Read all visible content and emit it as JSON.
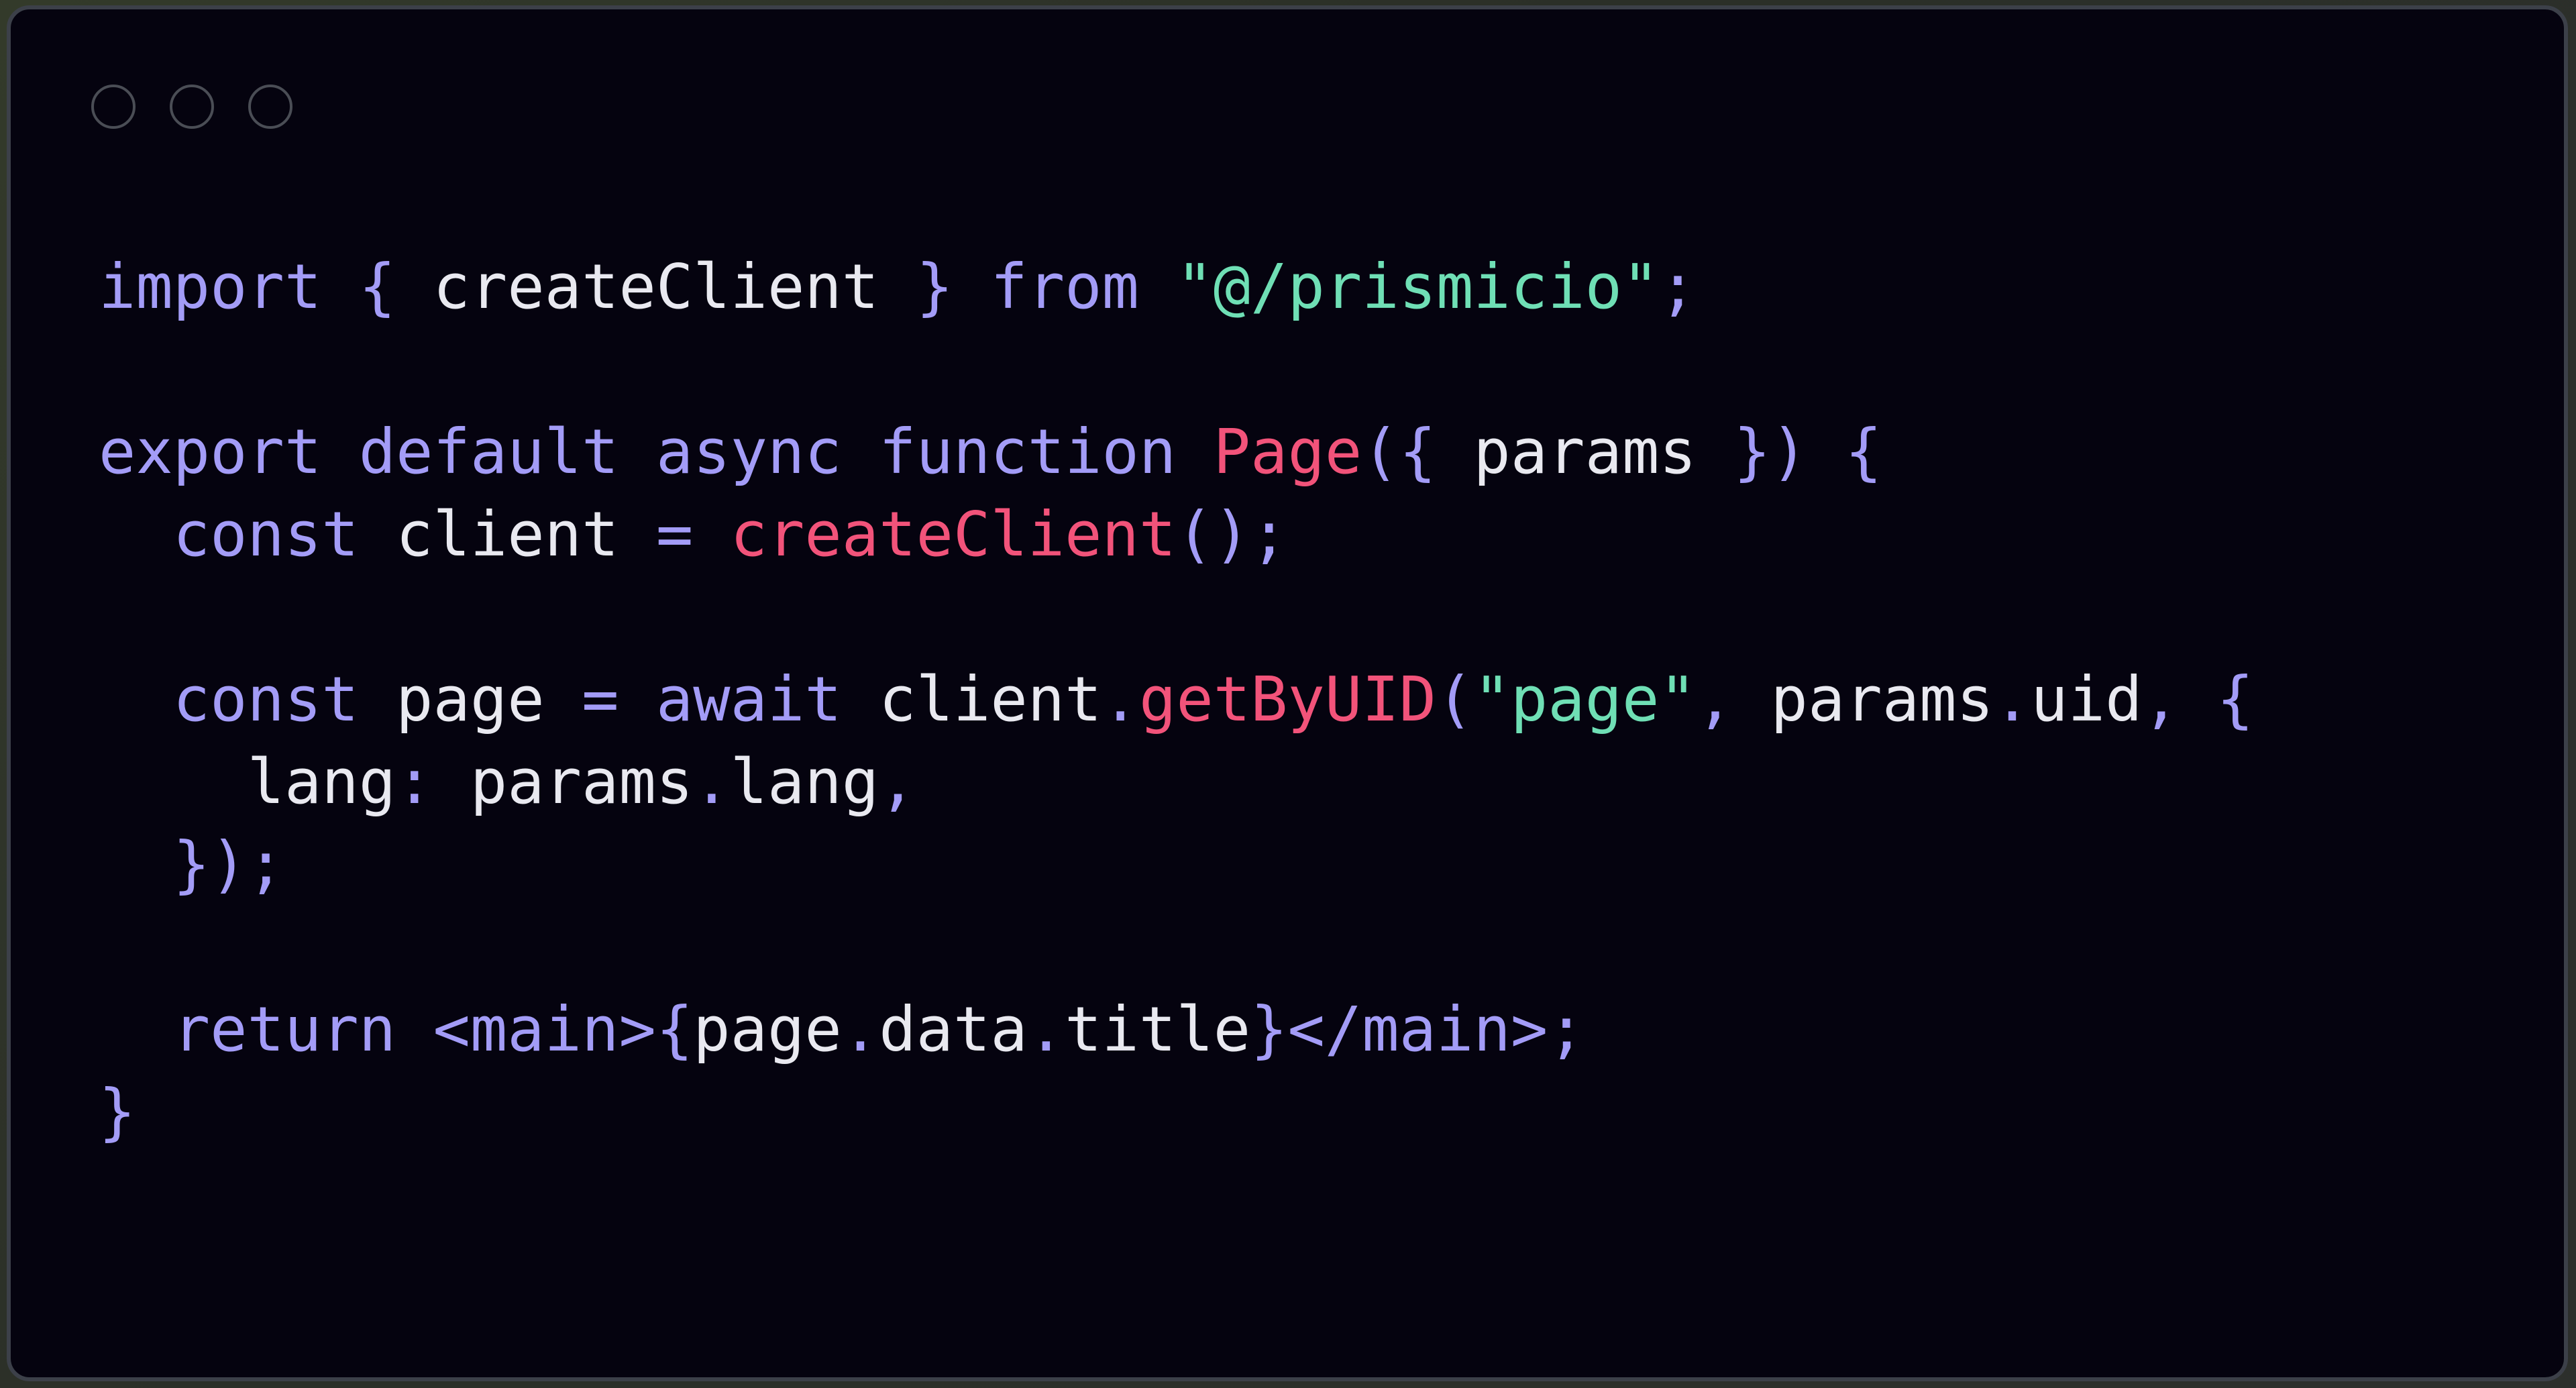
{
  "window": {
    "background_color": "#05030f",
    "border_color": "#3c4049",
    "page_background_color": "#2e3328",
    "traffic_lights": [
      {
        "name": "close-button",
        "label": "close"
      },
      {
        "name": "minimize-button",
        "label": "minimize"
      },
      {
        "name": "maximize-button",
        "label": "maximize"
      }
    ]
  },
  "theme": {
    "keyword_color": "#a39cf7",
    "function_color": "#f2537a",
    "string_color": "#6fdfb5",
    "identifier_color": "#e9e9f0"
  },
  "editor": {
    "language": "tsx",
    "full_text": "import { createClient } from \"@/prismicio\";\n\nexport default async function Page({ params }) {\n  const client = createClient();\n\n  const page = await client.getByUID(\"page\", params.uid, {\n    lang: params.lang,\n  });\n\n  return <main>{page.data.title}</main>;\n}",
    "lines": [
      {
        "n": 1,
        "tokens": [
          {
            "t": "import",
            "c": "kw"
          },
          {
            "t": " ",
            "c": "id"
          },
          {
            "t": "{",
            "c": "kw"
          },
          {
            "t": " createClient ",
            "c": "id"
          },
          {
            "t": "}",
            "c": "kw"
          },
          {
            "t": " ",
            "c": "id"
          },
          {
            "t": "from",
            "c": "kw"
          },
          {
            "t": " ",
            "c": "id"
          },
          {
            "t": "\"@/prismicio\"",
            "c": "str"
          },
          {
            "t": ";",
            "c": "kw"
          }
        ]
      },
      {
        "n": 2,
        "tokens": []
      },
      {
        "n": 3,
        "tokens": [
          {
            "t": "export default async function",
            "c": "kw"
          },
          {
            "t": " ",
            "c": "id"
          },
          {
            "t": "Page",
            "c": "fn"
          },
          {
            "t": "({",
            "c": "kw"
          },
          {
            "t": " params ",
            "c": "id"
          },
          {
            "t": "})",
            "c": "kw"
          },
          {
            "t": " ",
            "c": "id"
          },
          {
            "t": "{",
            "c": "kw"
          }
        ]
      },
      {
        "n": 4,
        "tokens": [
          {
            "t": "  ",
            "c": "id"
          },
          {
            "t": "const",
            "c": "kw"
          },
          {
            "t": " client ",
            "c": "id"
          },
          {
            "t": "=",
            "c": "kw"
          },
          {
            "t": " ",
            "c": "id"
          },
          {
            "t": "createClient",
            "c": "fn"
          },
          {
            "t": "();",
            "c": "kw"
          }
        ]
      },
      {
        "n": 5,
        "tokens": []
      },
      {
        "n": 6,
        "tokens": [
          {
            "t": "  ",
            "c": "id"
          },
          {
            "t": "const",
            "c": "kw"
          },
          {
            "t": " page ",
            "c": "id"
          },
          {
            "t": "=",
            "c": "kw"
          },
          {
            "t": " ",
            "c": "id"
          },
          {
            "t": "await",
            "c": "kw"
          },
          {
            "t": " client",
            "c": "id"
          },
          {
            "t": ".",
            "c": "kw"
          },
          {
            "t": "getByUID",
            "c": "fn"
          },
          {
            "t": "(",
            "c": "kw"
          },
          {
            "t": "\"page\"",
            "c": "str"
          },
          {
            "t": ",",
            "c": "kw"
          },
          {
            "t": " params",
            "c": "id"
          },
          {
            "t": ".",
            "c": "kw"
          },
          {
            "t": "uid",
            "c": "id"
          },
          {
            "t": ",",
            "c": "kw"
          },
          {
            "t": " ",
            "c": "id"
          },
          {
            "t": "{",
            "c": "kw"
          }
        ]
      },
      {
        "n": 7,
        "tokens": [
          {
            "t": "    lang",
            "c": "id"
          },
          {
            "t": ":",
            "c": "kw"
          },
          {
            "t": " params",
            "c": "id"
          },
          {
            "t": ".",
            "c": "kw"
          },
          {
            "t": "lang",
            "c": "id"
          },
          {
            "t": ",",
            "c": "kw"
          }
        ]
      },
      {
        "n": 8,
        "tokens": [
          {
            "t": "  ",
            "c": "id"
          },
          {
            "t": "});",
            "c": "kw"
          }
        ]
      },
      {
        "n": 9,
        "tokens": []
      },
      {
        "n": 10,
        "tokens": [
          {
            "t": "  ",
            "c": "id"
          },
          {
            "t": "return",
            "c": "kw"
          },
          {
            "t": " ",
            "c": "id"
          },
          {
            "t": "<main>",
            "c": "kw"
          },
          {
            "t": "{",
            "c": "kw"
          },
          {
            "t": "page",
            "c": "id"
          },
          {
            "t": ".",
            "c": "kw"
          },
          {
            "t": "data",
            "c": "id"
          },
          {
            "t": ".",
            "c": "kw"
          },
          {
            "t": "title",
            "c": "id"
          },
          {
            "t": "}",
            "c": "kw"
          },
          {
            "t": "</main>",
            "c": "kw"
          },
          {
            "t": ";",
            "c": "kw"
          }
        ]
      },
      {
        "n": 11,
        "tokens": [
          {
            "t": "}",
            "c": "kw"
          }
        ]
      }
    ]
  }
}
